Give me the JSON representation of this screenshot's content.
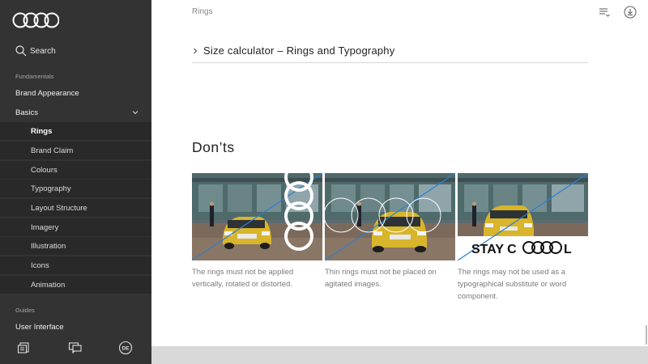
{
  "sidebar": {
    "search_label": "Search",
    "sections": [
      {
        "label": "Fundamentals"
      },
      {
        "label": "Guides"
      }
    ],
    "items": [
      {
        "label": "Brand Appearance"
      },
      {
        "label": "Basics"
      },
      {
        "label": "User Interface"
      }
    ],
    "sub_items": [
      {
        "label": "Rings",
        "active": true
      },
      {
        "label": "Brand Claim"
      },
      {
        "label": "Colours"
      },
      {
        "label": "Typography"
      },
      {
        "label": "Layout Structure"
      },
      {
        "label": "Imagery"
      },
      {
        "label": "Illustration"
      },
      {
        "label": "Icons"
      },
      {
        "label": "Animation"
      }
    ],
    "language_badge": "DE"
  },
  "topbar": {
    "breadcrumb": "Rings"
  },
  "accordion": {
    "label": "Size calculator – Rings and Typography"
  },
  "donts": {
    "title": "Don’ts",
    "cards": [
      {
        "caption": "The rings must not be applied vertically, rotated or distorted."
      },
      {
        "caption": "Thin rings must not be placed on agitated images."
      },
      {
        "caption": "The rings may not be used as a typographical substitute or word component.",
        "overlay_text": "STAY C",
        "overlay_suffix": "L"
      }
    ]
  },
  "colors": {
    "sidebar_bg": "#333333",
    "sidebar_sub_bg": "#292929",
    "accent_line": "#2a7fd4"
  }
}
